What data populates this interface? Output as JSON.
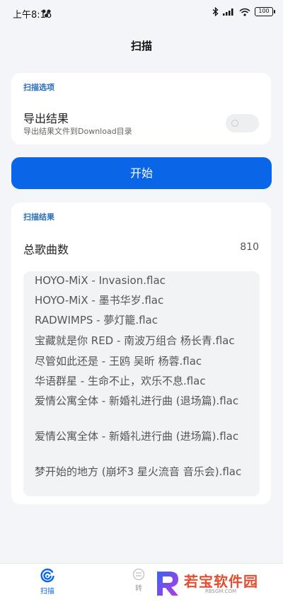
{
  "status_bar": {
    "time": "上午8:16",
    "battery": "100"
  },
  "header": {
    "title": "扫描"
  },
  "options_card": {
    "section_title": "扫描选项",
    "export_title": "导出结果",
    "export_subtitle": "导出结果文件到Download目录",
    "export_enabled": false
  },
  "start_button": {
    "label": "开始"
  },
  "results_card": {
    "section_title": "扫描结果",
    "total_label": "总歌曲数",
    "total_value": "810",
    "files": [
      "HOYO-MiX - Invasion.flac",
      "HOYO-MiX - 墨书华岁.flac",
      "RADWIMPS - 夢灯籠.flac",
      "宝藏就是你 RED - 南波万组合 杨长青.flac",
      "尽管如此还是 - 王鸥 吴昕 杨蓉.flac",
      "华语群星 - 生命不止，欢乐不息.flac",
      "爱情公寓全体 - 新婚礼进行曲 (退场篇).flac",
      "爱情公寓全体 - 新婚礼进行曲 (进场篇).flac",
      "梦开始的地方 (崩坏3 星火流音 音乐会).flac"
    ]
  },
  "bottom_nav": {
    "items": [
      {
        "label": "扫描",
        "icon": "scan-icon",
        "active": true
      },
      {
        "label": "转",
        "icon": "convert-icon",
        "active": false
      }
    ]
  },
  "watermark": {
    "text": "若宝软件园",
    "url": "RBSGM.COM",
    "logo": "R"
  },
  "colors": {
    "accent": "#0a66e6",
    "section_title": "#2a6fb8",
    "background": "#f3f5f8"
  }
}
